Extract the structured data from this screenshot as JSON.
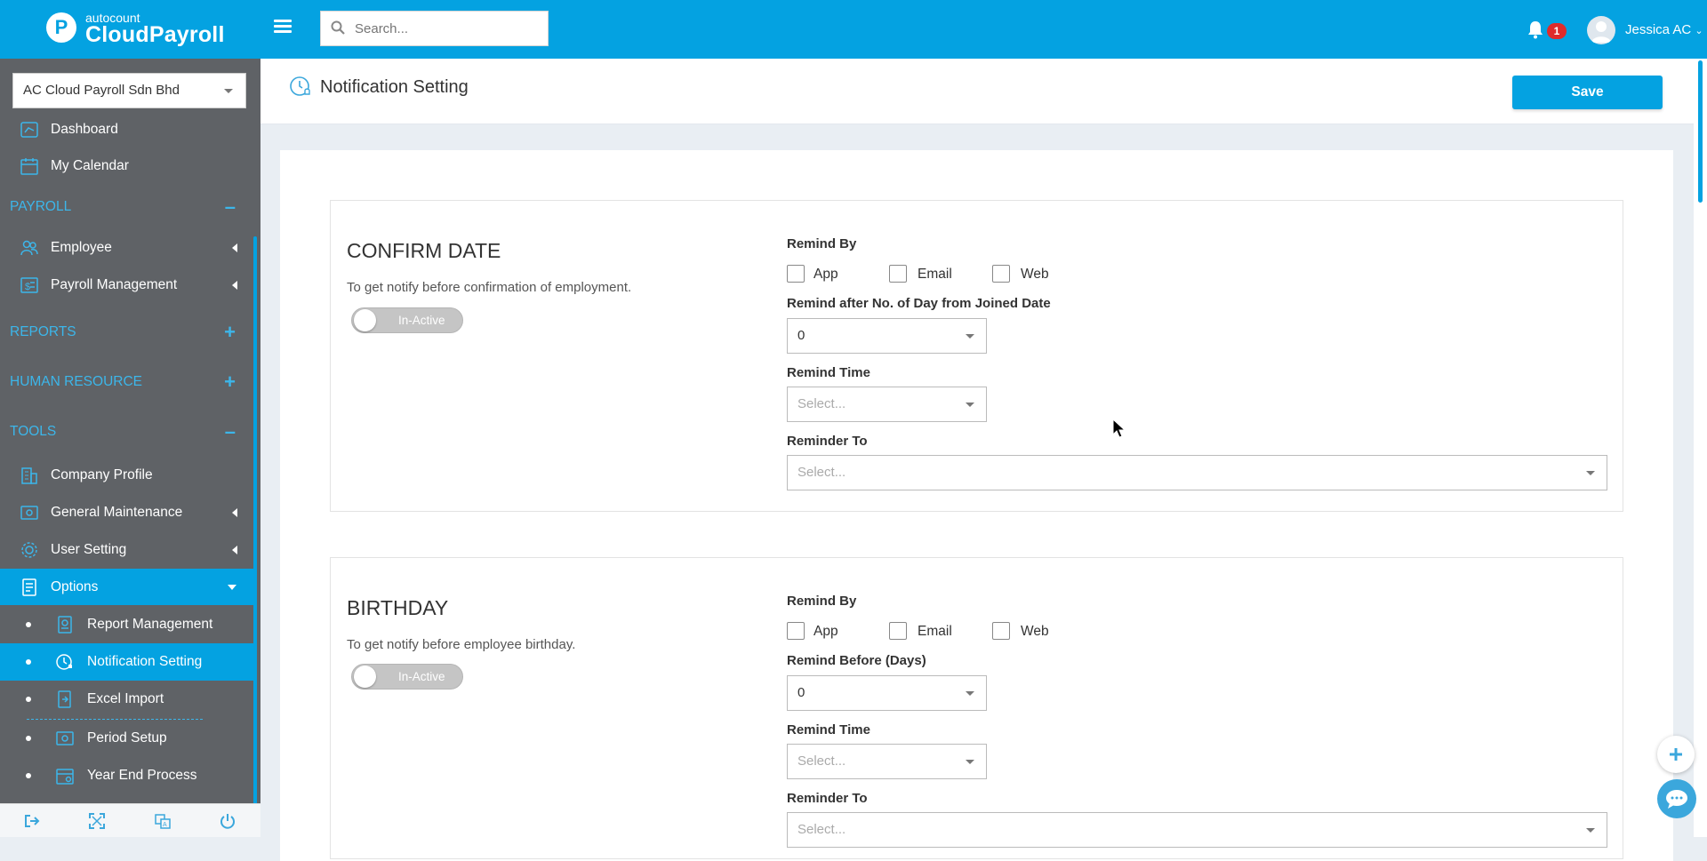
{
  "brand": {
    "small": "autocount",
    "big": "CloudPayroll",
    "logo_letter": "P"
  },
  "search": {
    "placeholder": "Search..."
  },
  "notifications": {
    "count": "1"
  },
  "user": {
    "name": "Jessica AC"
  },
  "company": {
    "selected": "AC Cloud Payroll Sdn Bhd"
  },
  "menu": {
    "dashboard": "Dashboard",
    "my_calendar": "My Calendar",
    "payroll_header": "PAYROLL",
    "employee": "Employee",
    "payroll_management": "Payroll Management",
    "reports_header": "REPORTS",
    "human_resource_header": "HUMAN RESOURCE",
    "tools_header": "TOOLS",
    "company_profile": "Company Profile",
    "general_maintenance": "General Maintenance",
    "user_setting": "User Setting",
    "options": "Options",
    "report_management": "Report Management",
    "notification_setting": "Notification Setting",
    "excel_import": "Excel Import",
    "period_setup": "Period Setup",
    "year_end_process": "Year End Process",
    "collapse_sign": "–",
    "expand_sign": "+"
  },
  "page": {
    "title": "Notification Setting",
    "save_label": "Save"
  },
  "sections": [
    {
      "title": "CONFIRM DATE",
      "description": "To get notify before confirmation of employment.",
      "status": "In-Active",
      "remind_by_label": "Remind By",
      "options": {
        "app": "App",
        "email": "Email",
        "web": "Web"
      },
      "days_label": "Remind after No. of Day from Joined Date",
      "days_value": "0",
      "time_label": "Remind Time",
      "time_placeholder": "Select...",
      "to_label": "Reminder To",
      "to_placeholder": "Select..."
    },
    {
      "title": "BIRTHDAY",
      "description": "To get notify before employee birthday.",
      "status": "In-Active",
      "remind_by_label": "Remind By",
      "options": {
        "app": "App",
        "email": "Email",
        "web": "Web"
      },
      "days_label": "Remind Before (Days)",
      "days_value": "0",
      "time_label": "Remind Time",
      "time_placeholder": "Select...",
      "to_label": "Reminder To",
      "to_placeholder": "Select..."
    }
  ],
  "colors": {
    "primary": "#04a2e1",
    "sidebar": "#5f6266",
    "badge": "#e02b2b",
    "toggle_off": "#c5c5c5"
  },
  "icons": [
    "menu-icon",
    "search-icon",
    "bell-icon",
    "user-avatar-icon",
    "clock-bell-icon",
    "plus-icon",
    "chat-icon",
    "logout-icon",
    "fullscreen-icon",
    "language-icon",
    "power-icon"
  ]
}
